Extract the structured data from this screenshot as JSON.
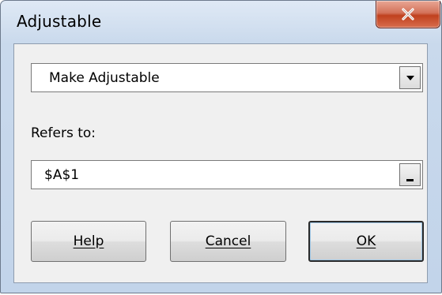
{
  "window": {
    "title": "Adjustable"
  },
  "combo": {
    "selected": "Make Adjustable"
  },
  "refers_to": {
    "label": "Refers to:",
    "value": "$A$1"
  },
  "buttons": {
    "help": "Help",
    "cancel": "Cancel",
    "ok": "OK"
  },
  "colors": {
    "close_button": "#c0411f",
    "window_frame": "#c9d9ec",
    "client_bg": "#f0f0f0"
  }
}
